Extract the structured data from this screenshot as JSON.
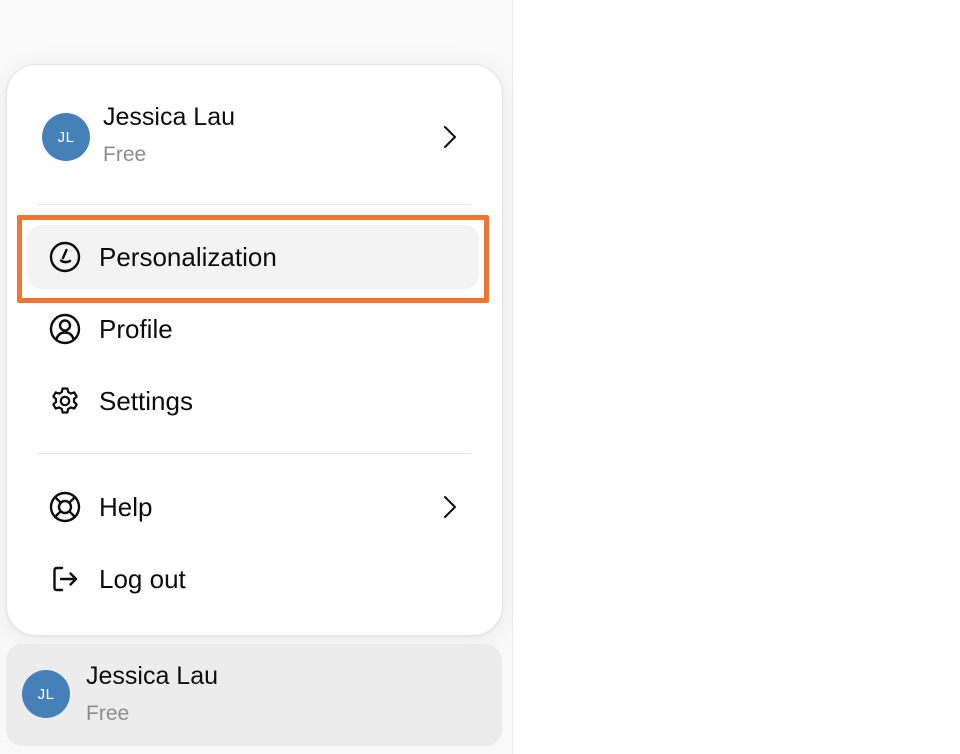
{
  "popup_menu": {
    "account": {
      "avatar_initials": "JL",
      "name": "Jessica Lau",
      "plan": "Free"
    },
    "items": [
      {
        "label": "Personalization",
        "icon": "personalization-icon",
        "highlighted": true
      },
      {
        "label": "Profile",
        "icon": "profile-icon"
      },
      {
        "label": "Settings",
        "icon": "gear-icon"
      }
    ],
    "secondary_items": [
      {
        "label": "Help",
        "icon": "help-lifebuoy-icon",
        "has_submenu": true
      },
      {
        "label": "Log out",
        "icon": "log-out-icon"
      }
    ]
  },
  "sidebar_footer": {
    "avatar_initials": "JL",
    "name": "Jessica Lau",
    "plan": "Free"
  },
  "colors": {
    "avatar": "#4680b8",
    "highlight_outline": "#f07530",
    "hover_bg": "#f3f3f3",
    "footer_bg": "#ececec"
  }
}
